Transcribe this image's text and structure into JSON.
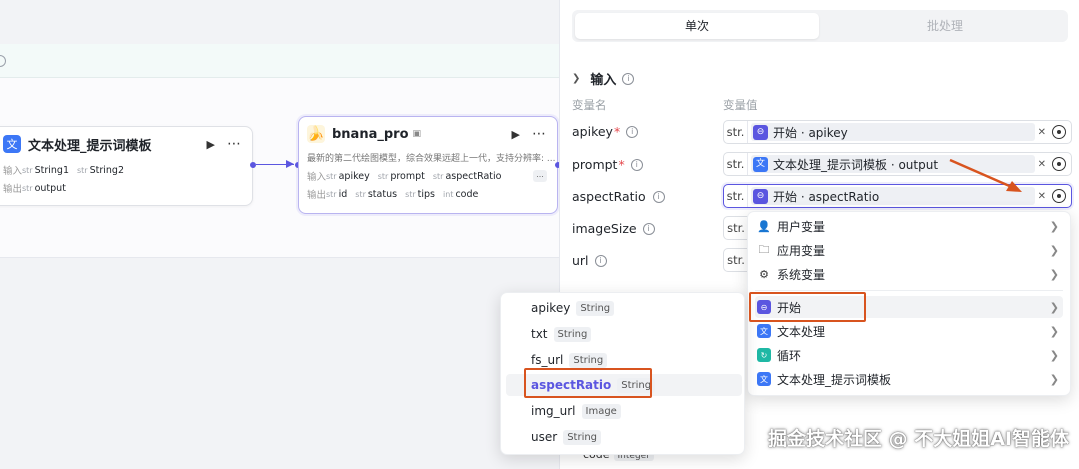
{
  "canvas": {
    "node_text": {
      "title": "文本处理_提示词模板",
      "input_label": "输入",
      "output_label": "输出",
      "inputs": [
        {
          "type": "str",
          "name": "String1"
        },
        {
          "type": "str",
          "name": "String2"
        }
      ],
      "outputs": [
        {
          "type": "str",
          "name": "output"
        }
      ]
    },
    "node_banana": {
      "title": "bnana_pro",
      "description": "最新的第二代绘图模型，综合效果远超上一代，支持分辨率: ...",
      "input_label": "输入",
      "output_label": "输出",
      "inputs": [
        {
          "type": "str",
          "name": "apikey"
        },
        {
          "type": "str",
          "name": "prompt"
        },
        {
          "type": "str",
          "name": "aspectRatio"
        }
      ],
      "outputs": [
        {
          "type": "str",
          "name": "id"
        },
        {
          "type": "str",
          "name": "status"
        },
        {
          "type": "str",
          "name": "tips"
        },
        {
          "type": "int",
          "name": "code"
        }
      ],
      "more": "..."
    }
  },
  "panel": {
    "tabs": {
      "active": "单次",
      "inactive": "批处理"
    },
    "section_title": "输入",
    "col_name": "变量名",
    "col_value": "变量值",
    "params": [
      {
        "name": "apikey",
        "required": "*",
        "type": "str.",
        "value": "开始 · apikey"
      },
      {
        "name": "prompt",
        "required": "*",
        "type": "str.",
        "value": "文本处理_提示词模板 · output"
      },
      {
        "name": "aspectRatio",
        "required": "",
        "type": "str.",
        "value": "开始 · aspectRatio"
      },
      {
        "name": "imageSize",
        "required": "",
        "type": "str.",
        "value": ""
      },
      {
        "name": "url",
        "required": "",
        "type": "str.",
        "value": ""
      }
    ],
    "below_item": {
      "name": "code",
      "type": "Integer"
    }
  },
  "menu": {
    "items": [
      {
        "label": "用户变量"
      },
      {
        "label": "应用变量"
      },
      {
        "label": "系统变量"
      },
      {
        "label": "开始"
      },
      {
        "label": "文本处理"
      },
      {
        "label": "循环"
      },
      {
        "label": "文本处理_提示词模板"
      }
    ]
  },
  "variables": [
    {
      "name": "apikey",
      "type": "String"
    },
    {
      "name": "txt",
      "type": "String"
    },
    {
      "name": "fs_url",
      "type": "String"
    },
    {
      "name": "aspectRatio",
      "type": "String"
    },
    {
      "name": "img_url",
      "type": "Image"
    },
    {
      "name": "user",
      "type": "String"
    }
  ],
  "watermark": "掘金技术社区 @ 不大姐姐AI智能体",
  "colors": {
    "accent": "#5b56e0",
    "annotation": "#d8541f",
    "node_blue": "#3c77f6"
  }
}
